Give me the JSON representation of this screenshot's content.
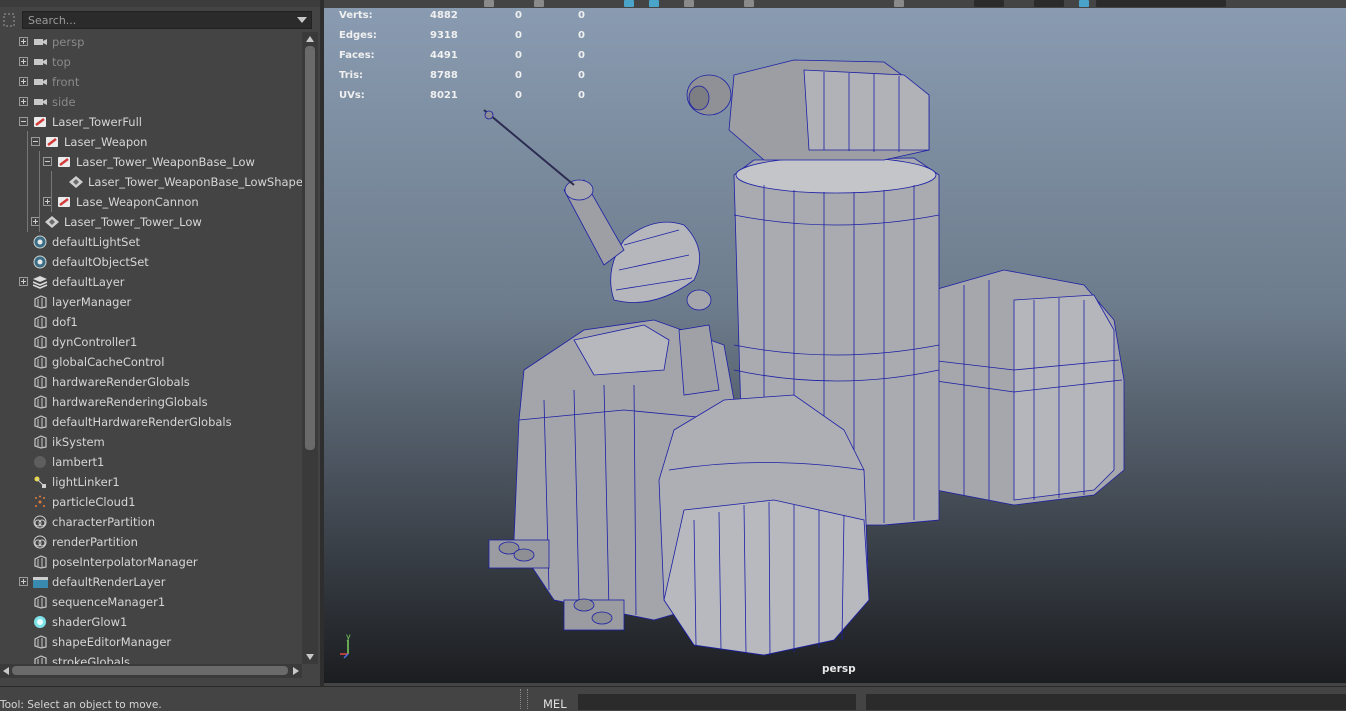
{
  "outliner": {
    "search": {
      "placeholder": "Search..."
    },
    "items": [
      {
        "label": "persp",
        "icon": "camera-icon",
        "expander": "plus",
        "indent": 0,
        "dim": true
      },
      {
        "label": "top",
        "icon": "camera-icon",
        "expander": "plus",
        "indent": 0,
        "dim": true
      },
      {
        "label": "front",
        "icon": "camera-icon",
        "expander": "plus",
        "indent": 0,
        "dim": true
      },
      {
        "label": "side",
        "icon": "camera-icon",
        "expander": "plus",
        "indent": 0,
        "dim": true
      },
      {
        "label": "Laser_TowerFull",
        "icon": "transform-icon",
        "expander": "minus",
        "indent": 0,
        "dim": false
      },
      {
        "label": "Laser_Weapon",
        "icon": "transform-icon",
        "expander": "minus",
        "indent": 1,
        "dim": false
      },
      {
        "label": "Laser_Tower_WeaponBase_Low",
        "icon": "transform-icon",
        "expander": "minus",
        "indent": 2,
        "dim": false
      },
      {
        "label": "Laser_Tower_WeaponBase_LowShape",
        "icon": "mesh-shape-icon",
        "expander": "none",
        "indent": 3,
        "dim": false
      },
      {
        "label": "Lase_WeaponCannon",
        "icon": "transform-icon",
        "expander": "plus",
        "indent": 2,
        "dim": false
      },
      {
        "label": "Laser_Tower_Tower_Low",
        "icon": "mesh-shape-icon",
        "expander": "plus",
        "indent": 1,
        "dim": false
      },
      {
        "label": "defaultLightSet",
        "icon": "set-icon",
        "expander": "none",
        "indent": 0,
        "dim": false
      },
      {
        "label": "defaultObjectSet",
        "icon": "set-icon",
        "expander": "none",
        "indent": 0,
        "dim": false
      },
      {
        "label": "defaultLayer",
        "icon": "layer-icon",
        "expander": "plus",
        "indent": 0,
        "dim": false
      },
      {
        "label": "layerManager",
        "icon": "node-icon",
        "expander": "none",
        "indent": 0,
        "dim": false
      },
      {
        "label": "dof1",
        "icon": "node-icon",
        "expander": "none",
        "indent": 0,
        "dim": false
      },
      {
        "label": "dynController1",
        "icon": "node-icon",
        "expander": "none",
        "indent": 0,
        "dim": false
      },
      {
        "label": "globalCacheControl",
        "icon": "node-icon",
        "expander": "none",
        "indent": 0,
        "dim": false
      },
      {
        "label": "hardwareRenderGlobals",
        "icon": "node-icon",
        "expander": "none",
        "indent": 0,
        "dim": false
      },
      {
        "label": "hardwareRenderingGlobals",
        "icon": "node-icon",
        "expander": "none",
        "indent": 0,
        "dim": false
      },
      {
        "label": "defaultHardwareRenderGlobals",
        "icon": "node-icon",
        "expander": "none",
        "indent": 0,
        "dim": false
      },
      {
        "label": "ikSystem",
        "icon": "node-icon",
        "expander": "none",
        "indent": 0,
        "dim": false
      },
      {
        "label": "lambert1",
        "icon": "material-sphere-icon",
        "expander": "none",
        "indent": 0,
        "dim": false
      },
      {
        "label": "lightLinker1",
        "icon": "light-linker-icon",
        "expander": "none",
        "indent": 0,
        "dim": false
      },
      {
        "label": "particleCloud1",
        "icon": "particle-icon",
        "expander": "none",
        "indent": 0,
        "dim": false
      },
      {
        "label": "characterPartition",
        "icon": "partition-icon",
        "expander": "none",
        "indent": 0,
        "dim": false
      },
      {
        "label": "renderPartition",
        "icon": "partition-icon",
        "expander": "none",
        "indent": 0,
        "dim": false
      },
      {
        "label": "poseInterpolatorManager",
        "icon": "node-icon",
        "expander": "none",
        "indent": 0,
        "dim": false
      },
      {
        "label": "defaultRenderLayer",
        "icon": "render-layer-icon",
        "expander": "plus",
        "indent": 0,
        "dim": false
      },
      {
        "label": "sequenceManager1",
        "icon": "node-icon",
        "expander": "none",
        "indent": 0,
        "dim": false
      },
      {
        "label": "shaderGlow1",
        "icon": "glow-icon",
        "expander": "none",
        "indent": 0,
        "dim": false
      },
      {
        "label": "shapeEditorManager",
        "icon": "node-icon",
        "expander": "none",
        "indent": 0,
        "dim": false
      },
      {
        "label": "strokeGlobals",
        "icon": "node-icon",
        "expander": "none",
        "indent": 0,
        "dim": false
      }
    ]
  },
  "viewport": {
    "camera_label": "persp",
    "hud": [
      {
        "label": "Verts:",
        "values": [
          "4882",
          "0",
          "0"
        ]
      },
      {
        "label": "Edges:",
        "values": [
          "9318",
          "0",
          "0"
        ]
      },
      {
        "label": "Faces:",
        "values": [
          "4491",
          "0",
          "0"
        ]
      },
      {
        "label": "Tris:",
        "values": [
          "8788",
          "0",
          "0"
        ]
      },
      {
        "label": "UVs:",
        "values": [
          "8021",
          "0",
          "0"
        ]
      }
    ],
    "axis": {
      "y": "y",
      "x": "x",
      "z": "z"
    }
  },
  "statusbar": {
    "help_text": "Tool: Select an object to move.",
    "mel_label": "MEL"
  },
  "colors": {
    "panel_bg": "#444444",
    "transform_icon": "#e05a5a",
    "axis_y": "#7cd35c",
    "axis_x": "#e04848",
    "axis_z": "#4a6ee8",
    "wire": "#1d1fa6"
  }
}
